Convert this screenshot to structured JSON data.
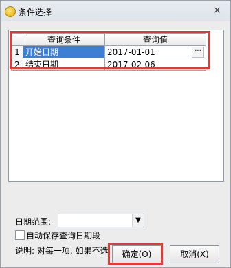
{
  "window": {
    "title": "条件选择",
    "close_glyph": "×"
  },
  "grid": {
    "headers": [
      "查询条件",
      "查询值"
    ],
    "rows": [
      {
        "num": "1",
        "name": "开始日期",
        "value": "2017-01-01",
        "selected": true
      },
      {
        "num": "2",
        "name": "结束日期",
        "value": "2017-02-06",
        "selected": false
      }
    ],
    "ellipsis": "···"
  },
  "date_range": {
    "label": "日期范围:",
    "value": "",
    "arrow": "▼"
  },
  "autosave": {
    "label": "自动保存查询日期段",
    "checked": false
  },
  "note": "说明: 对每一项, 如果不选, 则为全部!",
  "buttons": {
    "ok": "确定(O)",
    "cancel": "取消(X)"
  },
  "colors": {
    "highlight": "#e53935",
    "selection": "#3e7fd6"
  }
}
